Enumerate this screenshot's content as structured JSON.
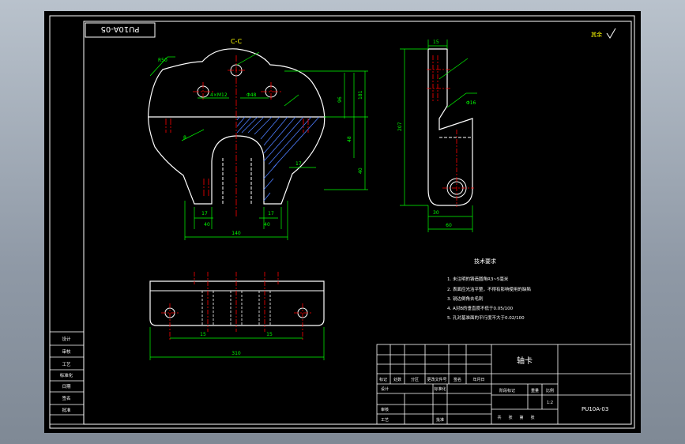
{
  "drawing": {
    "code_box": "PU10A-05",
    "section_label": "C-C",
    "roughness_note": "其余",
    "tech_title": "技术要求",
    "tech_notes": [
      "1. 未注明的铸造圆角R3~5毫米",
      "2. 表面应光洁平整，不得有影响使用的缺陷",
      "3. 锐边倒角去毛刺",
      "4. A对B的垂直度不低于0.05/100",
      "5. 孔对基准面的平行度不大于0.02/100"
    ],
    "title": "轴卡",
    "drawing_no": "PU10A-03",
    "scale": "1:2",
    "dims": {
      "d140": "140",
      "d17a": "17",
      "d17b": "17",
      "d40a": "40",
      "d40b": "40",
      "d40r": "40",
      "d96": "96",
      "d181": "181",
      "d48": "48",
      "d17r": "17",
      "d15": "15",
      "d60": "60",
      "d30": "30",
      "d207": "207",
      "d50": "50",
      "d310": "310",
      "d15b": "15",
      "d15c": "15",
      "r50": "R50",
      "m12": "4×M12",
      "d48h": "Φ48",
      "d8": "8",
      "d0": "Φ16"
    },
    "left_stamp": [
      "设计",
      "审核",
      "工艺",
      "标准化",
      "日期",
      "签名",
      "批准"
    ],
    "title_block": {
      "row1": [
        "标记",
        "处数",
        "分区",
        "更改文件号",
        "签名",
        "年月日"
      ],
      "row2": [
        "设计",
        "标准化"
      ],
      "row3": [
        "审核"
      ],
      "row4": [
        "工艺",
        "批准"
      ],
      "stage_labels": [
        "阶段标记",
        "重量",
        "比例"
      ],
      "sheet_labels": [
        "共",
        "张",
        "第",
        "张"
      ]
    }
  },
  "colors": {
    "background": "#000000",
    "frame": "#ffffff",
    "contour": "#ffffff",
    "dimension": "#00ff00",
    "center": "#ff0000",
    "hatch": "#4d7dff",
    "text": "#ffff00",
    "leader": "#00ffff"
  }
}
